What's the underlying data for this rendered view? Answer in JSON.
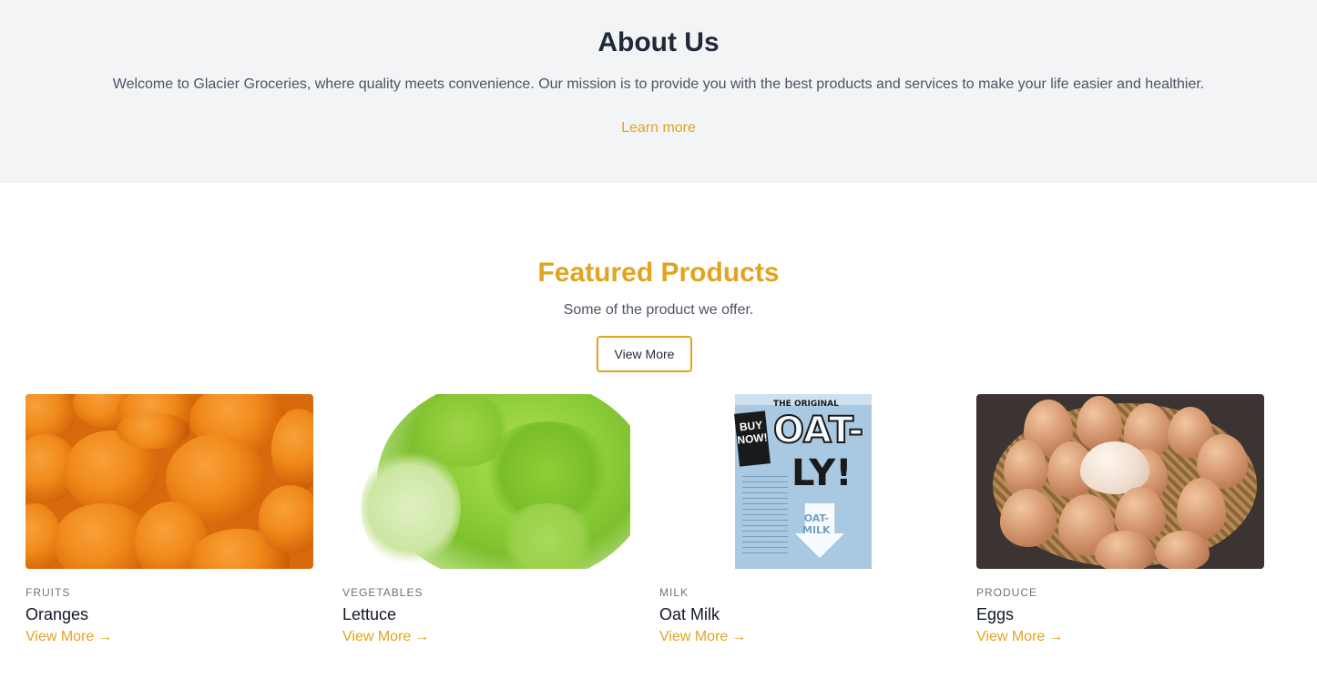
{
  "about": {
    "title": "About Us",
    "text": "Welcome to Glacier Groceries, where quality meets convenience. Our mission is to provide you with the best products and services to make your life easier and healthier.",
    "learn_more": "Learn more"
  },
  "featured": {
    "title": "Featured Products",
    "subtitle": "Some of the product we offer.",
    "button": "View More"
  },
  "products": [
    {
      "category": "FRUITS",
      "name": "Oranges",
      "link": "View More",
      "image": "oranges-photo"
    },
    {
      "category": "VEGETABLES",
      "name": "Lettuce",
      "link": "View More",
      "image": "lettuce-photo"
    },
    {
      "category": "MILK",
      "name": "Oat Milk",
      "link": "View More",
      "image": "oat-milk-carton-photo"
    },
    {
      "category": "PRODUCE",
      "name": "Eggs",
      "link": "View More",
      "image": "eggs-basket-photo"
    }
  ],
  "carton": {
    "brand": "THE ORIGINAL",
    "big1": "OAT-",
    "big2": "LY!",
    "badge": "BUY NOW!",
    "milk": "OAT-\nMILK"
  },
  "colors": {
    "accent": "#e0a421",
    "about_bg": "#f3f4f6"
  }
}
